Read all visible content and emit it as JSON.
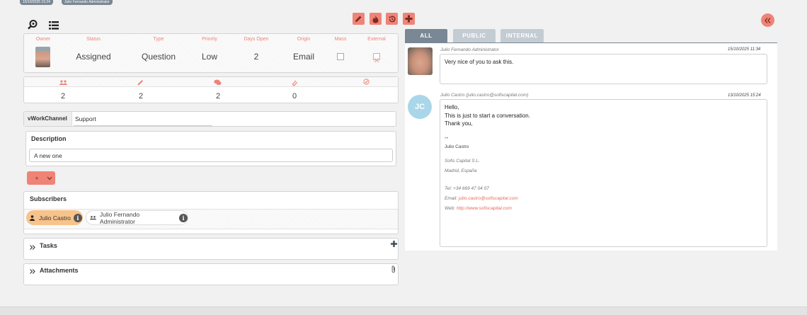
{
  "topbar": {
    "date_pill": "15/10/2025 15:24",
    "user_pill": "Julio Fernando Administrator"
  },
  "summary": {
    "headers": {
      "owner": "Owner",
      "status": "Status",
      "type": "Type",
      "priority": "Priority",
      "days_open": "Days Open",
      "origin": "Origin",
      "mass": "Mass",
      "external": "External"
    },
    "values": {
      "status": "Assigned",
      "type": "Question",
      "priority": "Low",
      "days_open": "2",
      "origin": "Email"
    }
  },
  "counters": {
    "subscribers": "2",
    "edits": "2",
    "comments": "2",
    "attachments": "0"
  },
  "work_channel": {
    "label": "vWorkChannel",
    "value": "Support"
  },
  "description": {
    "title": "Description",
    "value": "A new one"
  },
  "add_button": {
    "label": "+"
  },
  "subscribers": {
    "title": "Subscribers",
    "items": [
      {
        "name": "Julio Castro"
      },
      {
        "name": "Julio Fernando Administrator"
      }
    ]
  },
  "tasks": {
    "title": "Tasks"
  },
  "attachments": {
    "title": "Attachments"
  },
  "tabs": {
    "all": "ALL",
    "public": "PUBLIC",
    "internal": "INTERNAL"
  },
  "messages": [
    {
      "author": "Julio Fernando Administrator",
      "timestamp": "15/10/2025 11:34",
      "body": "Very nice of you to ask this."
    },
    {
      "author": "Julio Castro (julio.castro@sofiscapital.com)",
      "timestamp": "13/10/2025 15:24",
      "initials": "JC",
      "lines": [
        "Hello,",
        "This is just to start a conversation.",
        "Thank you,"
      ],
      "dashes": "--",
      "signature_name": "Julio Castro",
      "company": "Sofis Capital S.L.",
      "city": "Madrid, España",
      "tel": "Tel: +34 669 47 04 07",
      "email_label": "Email:",
      "email": "julio.castro@sofiscapital.com",
      "web_label": "Web:",
      "web": "http://www.sofiscapital.com"
    }
  ],
  "colors": {
    "accent": "#f08377",
    "tab_active": "#7a8794",
    "tab_inactive": "#c4ccd3",
    "jc_avatar": "#a9d6e8",
    "subscriber_highlight": "#f7c38a"
  },
  "icons": [
    "search-icon",
    "list-icon",
    "edit-icon",
    "fire-icon",
    "history-icon",
    "plus-icon",
    "collapse-left-icon",
    "users-icon",
    "pencil-icon",
    "comments-icon",
    "paperclip-icon",
    "check-icon",
    "user-icon",
    "info-icon",
    "chevron-double-right-icon"
  ]
}
